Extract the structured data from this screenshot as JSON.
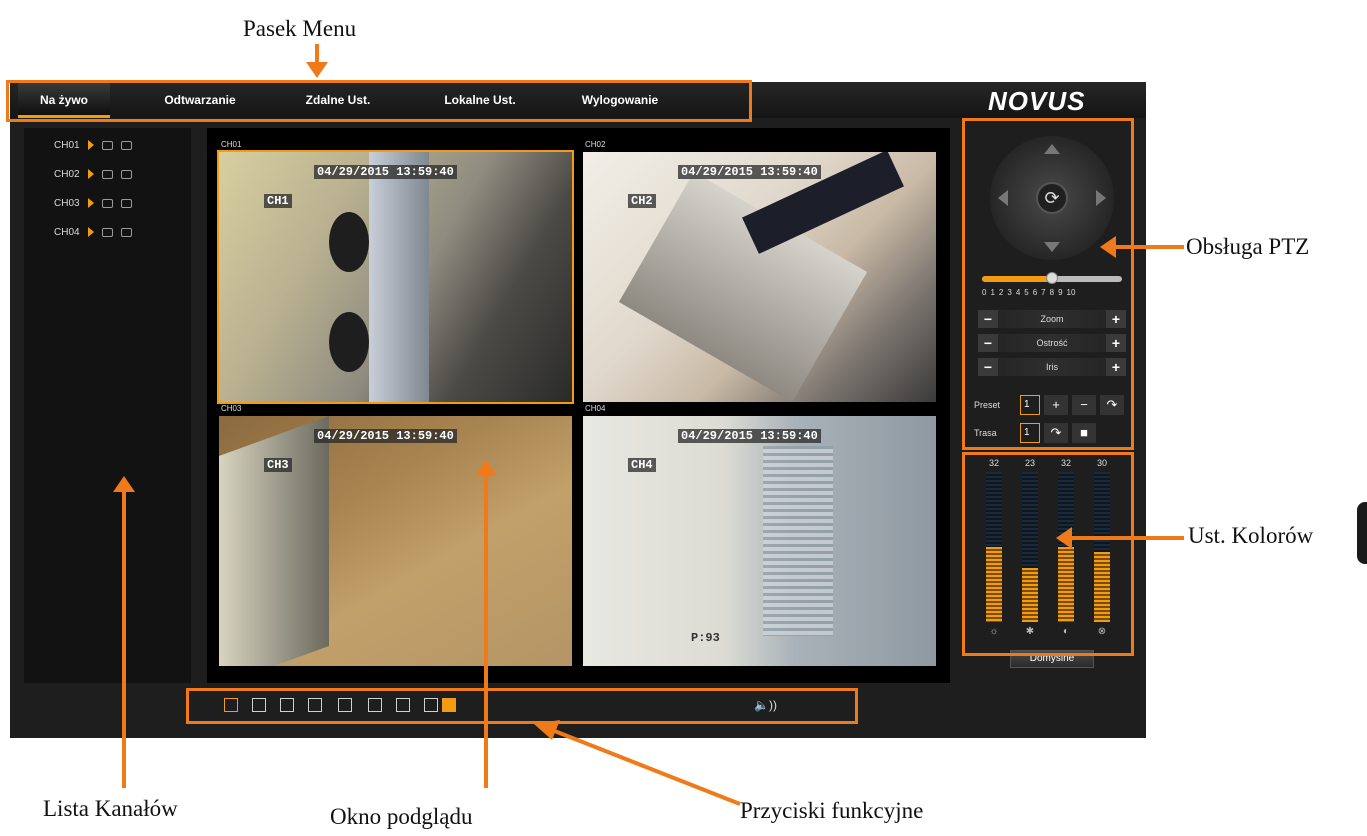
{
  "callouts": {
    "menu_bar": "Pasek Menu",
    "ptz": "Obsługa PTZ",
    "colors": "Ust. Kolorów",
    "channel_list": "Lista Kanałów",
    "preview": "Okno podglądu",
    "function_buttons": "Przyciski funkcyjne"
  },
  "menu": {
    "items": [
      "Na żywo",
      "Odtwarzanie",
      "Zdalne Ust.",
      "Lokalne Ust.",
      "Wylogowanie"
    ],
    "active": "Na żywo"
  },
  "logo": "NOVUS",
  "channels": [
    "CH01",
    "CH02",
    "CH03",
    "CH04"
  ],
  "cells": [
    {
      "label": "CH01",
      "timestamp": "04/29/2015 13:59:40",
      "channel_osd": "CH1",
      "selected": true
    },
    {
      "label": "CH02",
      "timestamp": "04/29/2015 13:59:40",
      "channel_osd": "CH2",
      "selected": false
    },
    {
      "label": "CH03",
      "timestamp": "04/29/2015 13:59:40",
      "channel_osd": "CH3",
      "selected": false
    },
    {
      "label": "CH04",
      "timestamp": "04/29/2015 13:59:40",
      "channel_osd": "CH4",
      "selected": false,
      "extra_osd": "P:93"
    }
  ],
  "ptz": {
    "speed_scale": [
      "0",
      "1",
      "2",
      "3",
      "4",
      "5",
      "6",
      "7",
      "8",
      "9",
      "10"
    ],
    "speed_value": 5,
    "zoom_label": "Zoom",
    "focus_label": "Ostrość",
    "iris_label": "Iris",
    "preset_label": "Preset",
    "preset_value": "1",
    "tour_label": "Trasa",
    "tour_value": "1"
  },
  "colors": {
    "values": [
      {
        "name": "brightness",
        "value": 32,
        "icon": "brightness-icon"
      },
      {
        "name": "contrast",
        "value": 23,
        "icon": "contrast-icon"
      },
      {
        "name": "saturation",
        "value": 32,
        "icon": "saturation-icon"
      },
      {
        "name": "hue",
        "value": 30,
        "icon": "hue-icon"
      }
    ],
    "max": 64,
    "default_label": "Domyślne"
  },
  "toolbar": {
    "buttons": [
      "play-icon",
      "stop-icon",
      "previous-screen-icon",
      "next-screen-icon",
      "fullscreen-icon",
      "fit-screen-icon",
      "split-layout-icon",
      "single-layout-icon"
    ],
    "sound_icon": "speaker-icon"
  },
  "theme": {
    "accent": "#f39c12",
    "callout_orange": "#f07a1a"
  }
}
